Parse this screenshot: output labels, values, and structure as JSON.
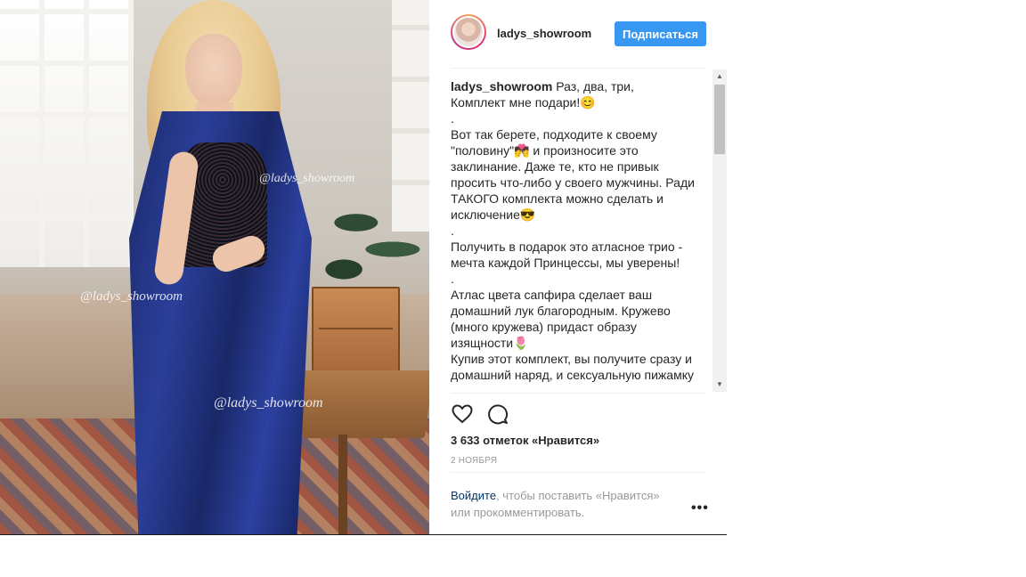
{
  "post": {
    "watermarks": [
      "@ladys_showroom",
      "@ladys_showroom",
      "@ladys_showroom"
    ]
  },
  "header": {
    "username": "ladys_showroom",
    "follow_label": "Подписаться"
  },
  "caption": {
    "username": "ladys_showroom",
    "lines": [
      "Раз, два, три,",
      "Комплект мне подари!😊",
      ".",
      "Вот так берете, подходите к своему \"половину\"💏 и произносите это заклинание. Даже те, кто не привык просить что-либо у своего мужчины. Ради ТАКОГО комплекта можно сделать и исключение😎",
      ".",
      "Получить в подарок это атласное трио - мечта каждой Принцессы, мы уверены!",
      ".",
      "Атлас цвета сапфира сделает ваш домашний лук благородным. Кружево (много кружева) придаст образу изящности🌷",
      "Купив этот комплект, вы получите сразу и домашний наряд, и сексуальную пижамку"
    ]
  },
  "icons": {
    "like": "heart-icon",
    "comment": "comment-icon",
    "more": "more-options-icon",
    "scroll_up": "scroll-up-arrow",
    "scroll_down": "scroll-down-arrow"
  },
  "stats": {
    "likes_text": "3 633 отметок «Нравится»",
    "date": "2 НОЯБРЯ"
  },
  "login": {
    "link_text": "Войдите",
    "rest_text": ", чтобы поставить «Нравится» или прокомментировать."
  },
  "more_label": "•••",
  "colors": {
    "follow_button": "#3897f0",
    "login_link": "#003569",
    "muted_text": "#999999"
  }
}
